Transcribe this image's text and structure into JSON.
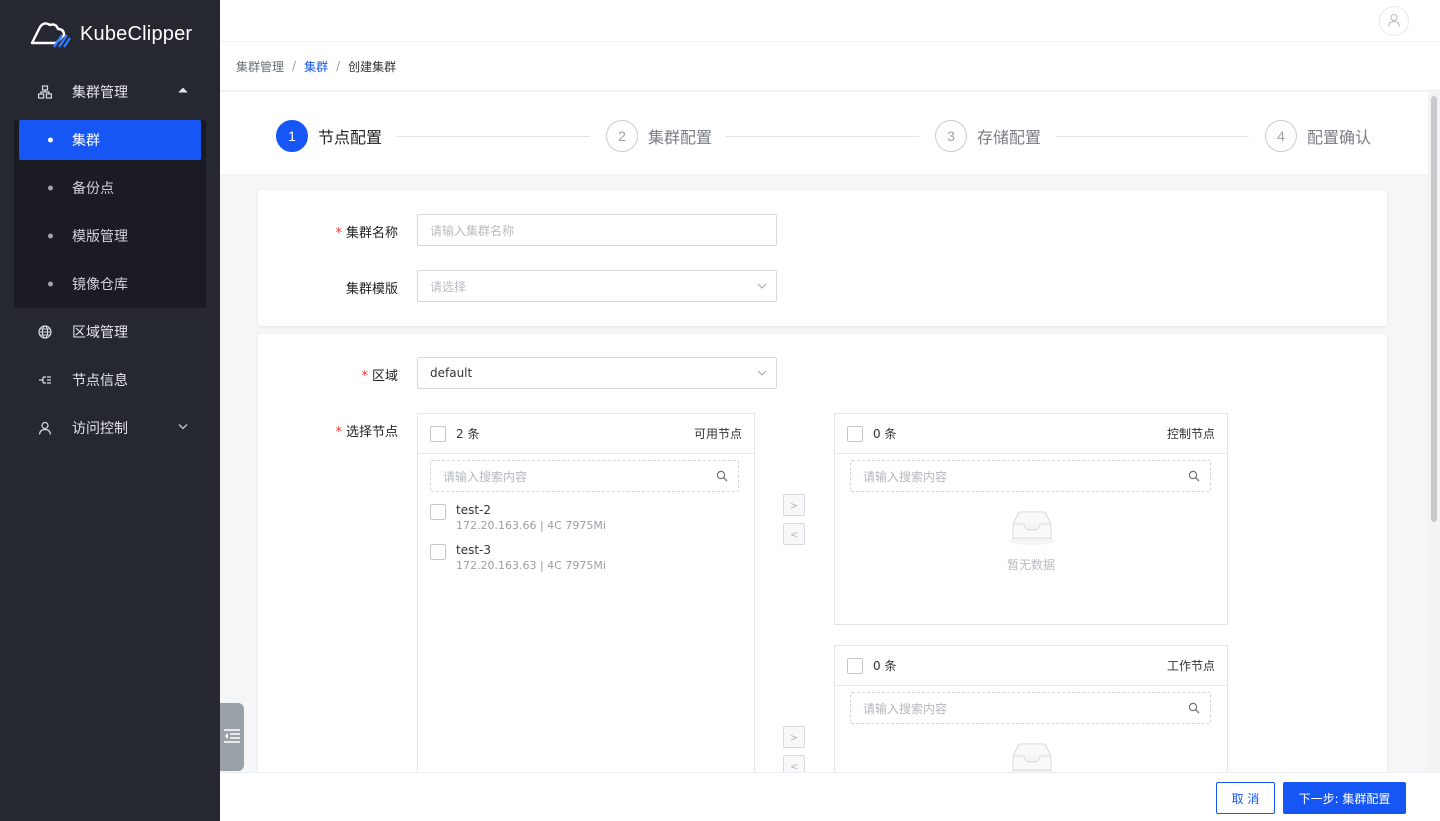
{
  "app": {
    "name": "KubeClipper"
  },
  "sidebar": {
    "items": [
      {
        "label": "集群管理",
        "icon": "cluster-icon",
        "expanded": true
      },
      {
        "label": "区域管理",
        "icon": "globe-icon"
      },
      {
        "label": "节点信息",
        "icon": "node-icon"
      },
      {
        "label": "访问控制",
        "icon": "user-icon"
      }
    ],
    "subitems": [
      {
        "label": "集群",
        "active": true
      },
      {
        "label": "备份点"
      },
      {
        "label": "模版管理"
      },
      {
        "label": "镜像仓库"
      }
    ]
  },
  "breadcrumb": {
    "root": "集群管理",
    "parent": "集群",
    "current": "创建集群",
    "sep": "/"
  },
  "steps": [
    {
      "num": "1",
      "label": "节点配置",
      "active": true
    },
    {
      "num": "2",
      "label": "集群配置"
    },
    {
      "num": "3",
      "label": "存储配置"
    },
    {
      "num": "4",
      "label": "配置确认"
    }
  ],
  "form": {
    "required_mark": "*",
    "cluster_name": {
      "label": "集群名称",
      "placeholder": "请输入集群名称"
    },
    "cluster_template": {
      "label": "集群模版",
      "placeholder": "请选择"
    },
    "region": {
      "label": "区域",
      "value": "default"
    },
    "select_nodes": {
      "label": "选择节点"
    }
  },
  "transfer": {
    "search_placeholder": "请输入搜索内容",
    "empty_text": "暂无数据",
    "available": {
      "count": "2 条",
      "title": "可用节点",
      "nodes": [
        {
          "name": "test-2",
          "detail": "172.20.163.66 | 4C 7975Mi"
        },
        {
          "name": "test-3",
          "detail": "172.20.163.63 | 4C 7975Mi"
        }
      ]
    },
    "control": {
      "count": "0 条",
      "title": "控制节点"
    },
    "worker": {
      "count": "0 条",
      "title": "工作节点"
    },
    "move_right": ">",
    "move_left": "<"
  },
  "footer": {
    "cancel": "取 消",
    "next": "下一步: 集群配置"
  },
  "colors": {
    "primary": "#1556f5",
    "sidebar_bg": "#252731",
    "required": "#f23030"
  }
}
